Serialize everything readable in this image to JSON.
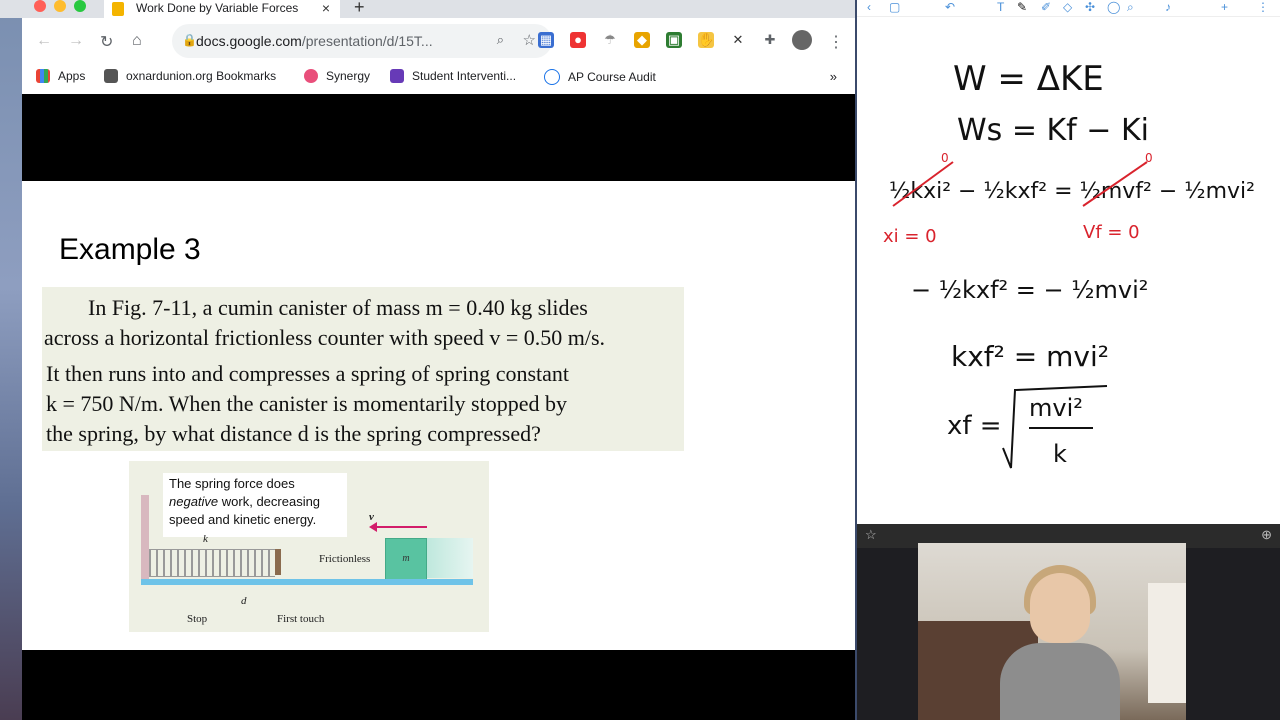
{
  "browser": {
    "tab_title": "Work Done by Variable Forces",
    "tab_close": "×",
    "new_tab": "+",
    "url_main": "docs.google.com",
    "url_rest": "/presentation/d/15T...",
    "bookmarks": [
      "Apps",
      "oxnardunion.org Bookmarks",
      "Synergy",
      "Student Interventi...",
      "AP Course Audit"
    ],
    "bookmarks_more": "»"
  },
  "slide": {
    "title": "Example 3",
    "problem_lines": [
      "In Fig. 7-11, a cumin canister of mass m = 0.40 kg slides",
      "across a horizontal frictionless counter with speed v = 0.50 m/s.",
      "It then runs into and compresses a spring of spring constant",
      "k = 750 N/m. When the canister is momentarily stopped by",
      "the spring, by what distance d is the spring compressed?"
    ],
    "figure": {
      "caption_1": "The spring force does",
      "caption_2a": "negative",
      "caption_2b": " work, decreasing",
      "caption_3": "speed and kinetic energy.",
      "k_label": "k",
      "v_label": "v",
      "m_label": "m",
      "frictionless": "Frictionless",
      "d_label": "d",
      "stop": "Stop",
      "first_touch": "First touch"
    }
  },
  "notes": {
    "line1": "W = ΔKE",
    "line2": "Ws = Kf − Ki",
    "line3": "½kxi² − ½kxf² = ½mvf² − ½mvi²",
    "red_zero_1": "0",
    "red_zero_2": "0",
    "red_xi": "xi = 0",
    "red_vf": "Vf = 0",
    "line4": "− ½kxf² = − ½mvi²",
    "line5": "kxf² = mvi²",
    "line6_left": "xf =",
    "line6_num": "mvi²",
    "line6_den": "k"
  }
}
